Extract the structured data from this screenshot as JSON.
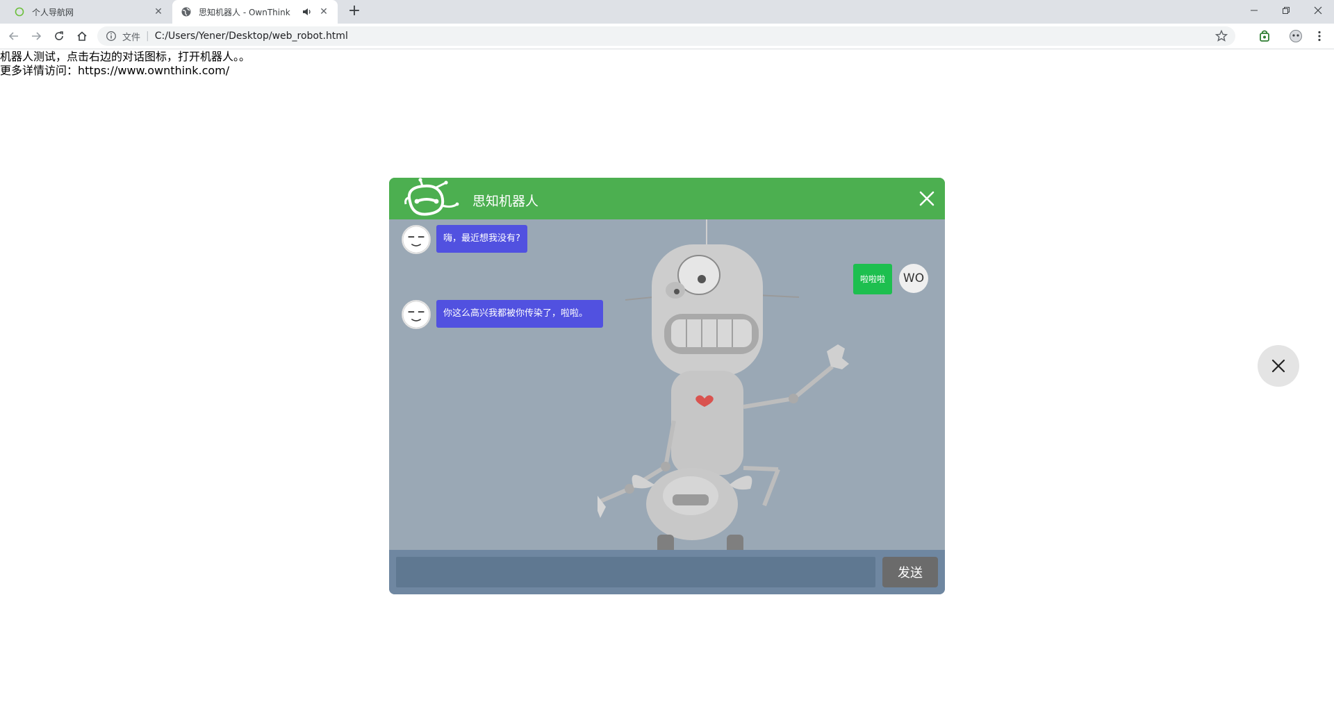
{
  "browser": {
    "tabs": [
      {
        "title": "个人导航网",
        "active": false
      },
      {
        "title": "思知机器人 - OwnThink",
        "active": true
      }
    ],
    "address": {
      "scheme_label": "文件",
      "url": "C:/Users/Yener/Desktop/web_robot.html"
    },
    "icons": [
      "back-arrow-icon",
      "forward-arrow-icon",
      "reload-icon",
      "home-icon",
      "info-icon",
      "star-icon",
      "extension-icon",
      "profile-icon",
      "menu-dots-icon"
    ]
  },
  "page": {
    "line1": "机器人测试，点击右边的对话图标，打开机器人。。",
    "line2": "更多详情访问：https://www.ownthink.com/"
  },
  "chat": {
    "title": "思知机器人",
    "header_color": "#4caf50",
    "messages": [
      {
        "from": "bot",
        "text": "嗨，最近想我没有?"
      },
      {
        "from": "user",
        "text": "啦啦啦",
        "avatar_label": "WO"
      },
      {
        "from": "bot",
        "text": "你这么高兴我都被你传染了，啦啦。"
      }
    ],
    "input": {
      "value": "",
      "placeholder": ""
    },
    "send_label": "发送",
    "bot_bubble_color": "#5151e0",
    "user_bubble_color": "#1dbf4f"
  }
}
